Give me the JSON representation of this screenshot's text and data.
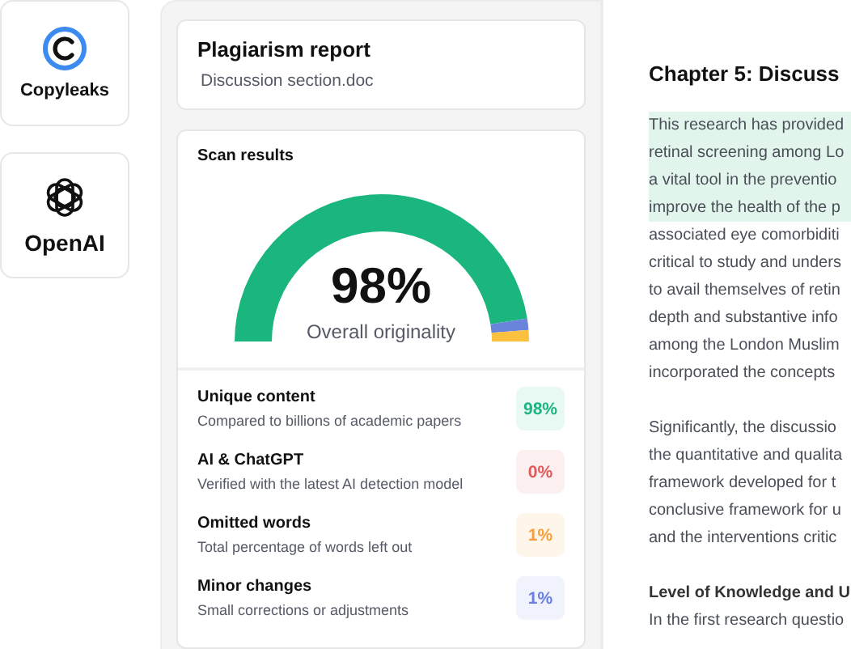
{
  "logos": [
    {
      "kind": "copyleaks",
      "label": "Copyleaks"
    },
    {
      "kind": "openai",
      "label": "OpenAI"
    }
  ],
  "report": {
    "title": "Plagiarism report",
    "file": "Discussion section.doc"
  },
  "scan": {
    "title": "Scan results",
    "gauge": {
      "value": "98%",
      "caption": "Overall originality"
    },
    "metrics": [
      {
        "title": "Unique content",
        "subtitle": "Compared to billions of academic papers",
        "value": "98%",
        "color": "#1db57f"
      },
      {
        "title": "AI & ChatGPT",
        "subtitle": "Verified with the latest AI detection model",
        "value": "0%",
        "color": "#e05a5a"
      },
      {
        "title": "Omitted words",
        "subtitle": "Total percentage of words left out",
        "value": "1%",
        "color": "#f5a03a"
      },
      {
        "title": "Minor changes",
        "subtitle": "Small corrections or adjustments",
        "value": "1%",
        "color": "#6a7fe0"
      }
    ]
  },
  "document": {
    "title": "Chapter 5: Discuss",
    "blocks": [
      {
        "kind": "paragraph",
        "lines": [
          {
            "text": "This research has provided",
            "highlighted": true
          },
          {
            "text": "retinal screening among Lo",
            "highlighted": true
          },
          {
            "text": "a vital tool in the preventio",
            "highlighted": true
          },
          {
            "text": "improve the health of the p",
            "highlighted": true
          },
          {
            "text": "associated eye comorbiditi",
            "highlighted": false
          },
          {
            "text": "critical to study and unders",
            "highlighted": false
          },
          {
            "text": "to avail themselves of retin",
            "highlighted": false
          },
          {
            "text": "depth and substantive info",
            "highlighted": false
          },
          {
            "text": "among the London Muslim",
            "highlighted": false
          },
          {
            "text": "incorporated the concepts",
            "highlighted": false
          }
        ]
      },
      {
        "kind": "paragraph",
        "lines": [
          {
            "text": "Significantly, the discussio",
            "highlighted": false
          },
          {
            "text": "the quantitative and qualita",
            "highlighted": false
          },
          {
            "text": "framework developed for t",
            "highlighted": false
          },
          {
            "text": "conclusive framework for u",
            "highlighted": false
          },
          {
            "text": "and the interventions critic",
            "highlighted": false
          }
        ]
      },
      {
        "kind": "heading",
        "text": "Level of Knowledge and U"
      },
      {
        "kind": "paragraph",
        "lines": [
          {
            "text": "In the first research questio",
            "highlighted": false
          }
        ]
      }
    ]
  }
}
